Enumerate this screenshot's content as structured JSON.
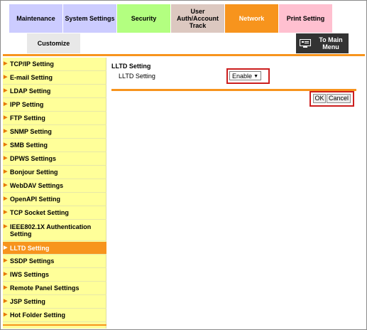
{
  "tabs": [
    {
      "label": "Maintenance",
      "bg": "#ccccff"
    },
    {
      "label": "System Settings",
      "bg": "#ccccff"
    },
    {
      "label": "Security",
      "bg": "#b3ff80"
    },
    {
      "label": "User Auth/Account Track",
      "bg": "#dcc8c0"
    },
    {
      "label": "Network",
      "bg": "#f7941d"
    },
    {
      "label": "Print Setting",
      "bg": "#ffc0d0"
    }
  ],
  "customize_tab": {
    "label": "Customize"
  },
  "main_menu_button": {
    "label": "To Main Menu",
    "icon": "monitor-icon"
  },
  "sidebar": {
    "items": [
      {
        "label": "TCP/IP Setting"
      },
      {
        "label": "E-mail Setting"
      },
      {
        "label": "LDAP Setting"
      },
      {
        "label": "IPP Setting"
      },
      {
        "label": "FTP Setting"
      },
      {
        "label": "SNMP Setting"
      },
      {
        "label": "SMB Setting"
      },
      {
        "label": "DPWS Settings"
      },
      {
        "label": "Bonjour Setting"
      },
      {
        "label": "WebDAV Settings"
      },
      {
        "label": "OpenAPI Setting"
      },
      {
        "label": "TCP Socket Setting"
      },
      {
        "label": "IEEE802.1X Authentication Setting"
      },
      {
        "label": "LLTD Setting"
      },
      {
        "label": "SSDP Settings"
      },
      {
        "label": "IWS Settings"
      },
      {
        "label": "Remote Panel Settings"
      },
      {
        "label": "JSP Setting"
      },
      {
        "label": "Hot Folder Setting"
      }
    ],
    "active_index": 13
  },
  "main": {
    "title": "LLTD Setting",
    "field_label": "LLTD Setting",
    "select_value": "Enable",
    "ok_label": "OK",
    "cancel_label": "Cancel"
  },
  "colors": {
    "accent": "#f7941d",
    "sidebar_bg": "#ffff99",
    "highlight": "#cc1e1e"
  }
}
